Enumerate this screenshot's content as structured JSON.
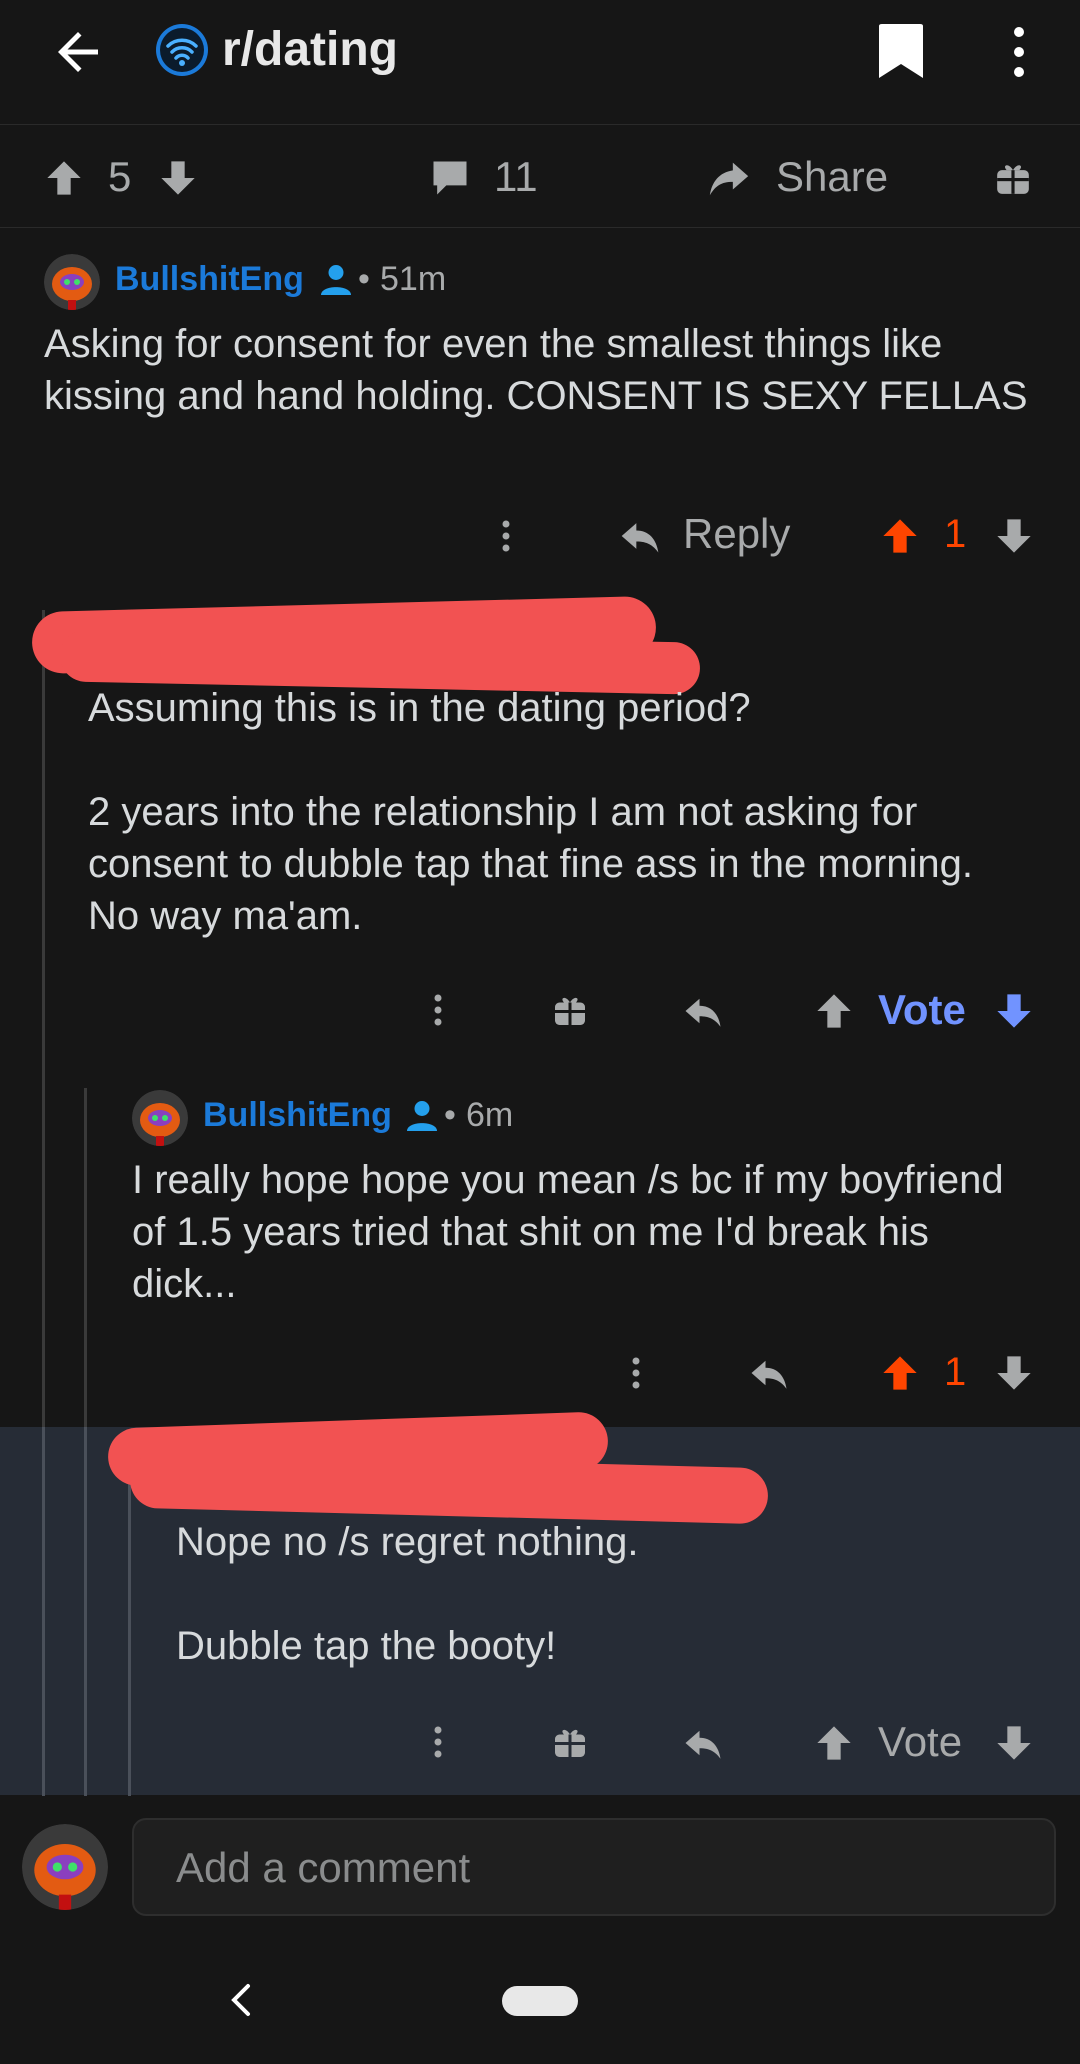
{
  "header": {
    "subreddit": "r/dating"
  },
  "post_actions": {
    "upvotes": "5",
    "comments": "11",
    "share_label": "Share"
  },
  "comments": [
    {
      "author": "BullshitEng",
      "time": "51m",
      "body": "Asking for consent for even the smallest things like kissing and hand holding. CONSENT IS SEXY FELLAS",
      "reply_label": "Reply",
      "score": "1"
    },
    {
      "body": "Assuming this is in the dating period?\n\n2 years into the relationship I am not asking for consent to dubble tap that fine ass in the morning. No way ma'am.",
      "vote_label": "Vote"
    },
    {
      "author": "BullshitEng",
      "time": "6m",
      "body": "I really hope hope you mean /s bc if my boyfriend of 1.5 years tried that shit on me I'd break his dick...",
      "score": "1"
    },
    {
      "body": "Nope no /s regret nothing.\n\nDubble tap the booty!",
      "vote_label": "Vote"
    }
  ],
  "composer": {
    "placeholder": "Add a comment"
  },
  "colors": {
    "background": "#161616",
    "username": "#1b7ad9",
    "upvote_active": "#ff4500",
    "vote_blue": "#7193ff",
    "highlight_bg": "#262c36",
    "redaction": "#f25252"
  }
}
